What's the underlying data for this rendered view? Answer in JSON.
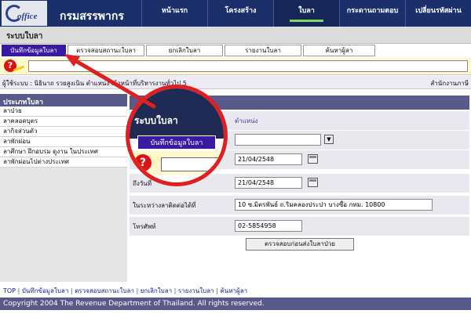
{
  "header": {
    "logo_text": "office",
    "site_title": "กรมสรรพากร",
    "nav": [
      "หน้าแรก",
      "โครงสร้าง",
      "ใบลา",
      "กระดานถามตอบ",
      "เปลี่ยนรหัสผ่าน"
    ],
    "active_nav_index": 2
  },
  "system": {
    "title": "ระบบใบลา"
  },
  "tabs": [
    "บันทึกข้อมูลใบลา",
    "ตรวจสอบสถานะใบลา",
    "ยกเลิกใบลา",
    "รายงานใบลา",
    "ค้นหาผู้ลา"
  ],
  "user": {
    "info": "ผู้ใช้ระบบ : นิธินาถ รวยสูงเนิน  ตำแหน่ง เจ้าหน้าที่บริหารงานทั่วไป 5",
    "office": "สำนักงานภาษี"
  },
  "sidebar": {
    "title": "ประเภทใบลา",
    "items": [
      "ลาป่วย",
      "ลาคลอดบุตร",
      "ลากิจส่วนตัว",
      "ลาพักผ่อน",
      "ลาศึกษา ฝึกอบรม ดูงาน ในประเทศ",
      "ลาพักผ่อนไปต่างประเทศ"
    ]
  },
  "form": {
    "position_label": "ตำแหน่ง",
    "start_date": "21/04/2548",
    "end_label": "ถึงวันที่",
    "end_date": "21/04/2548",
    "address_label": "ในระหว่างลาติดต่อได้ที่",
    "address": "10 ซ.มิตรพันธ์ ถ.ริมคลองประปา บางซื่อ กทม. 10800",
    "phone_label": "โทรศัพท์",
    "phone": "02-5854958",
    "submit_label": "ตรวจสอบก่อนส่งใบลาป่วย"
  },
  "magnifier": {
    "title": "ระบบใบลา",
    "tab": "บันทึกข้อมูลใบลา"
  },
  "footer": {
    "links": [
      "TOP",
      "บันทึกข้อมูลใบลา",
      "ตรวจสอบสถานะใบลา",
      "ยกเลิกใบลา",
      "รายงานใบลา",
      "ค้นหาผู้ลา"
    ],
    "copyright": "Copyright 2004 The Revenue Department of Thailand. All rights reserved."
  },
  "colors": {
    "header": "#1b2f6b",
    "accent": "#3a1aa0",
    "highlight": "#e02020"
  }
}
